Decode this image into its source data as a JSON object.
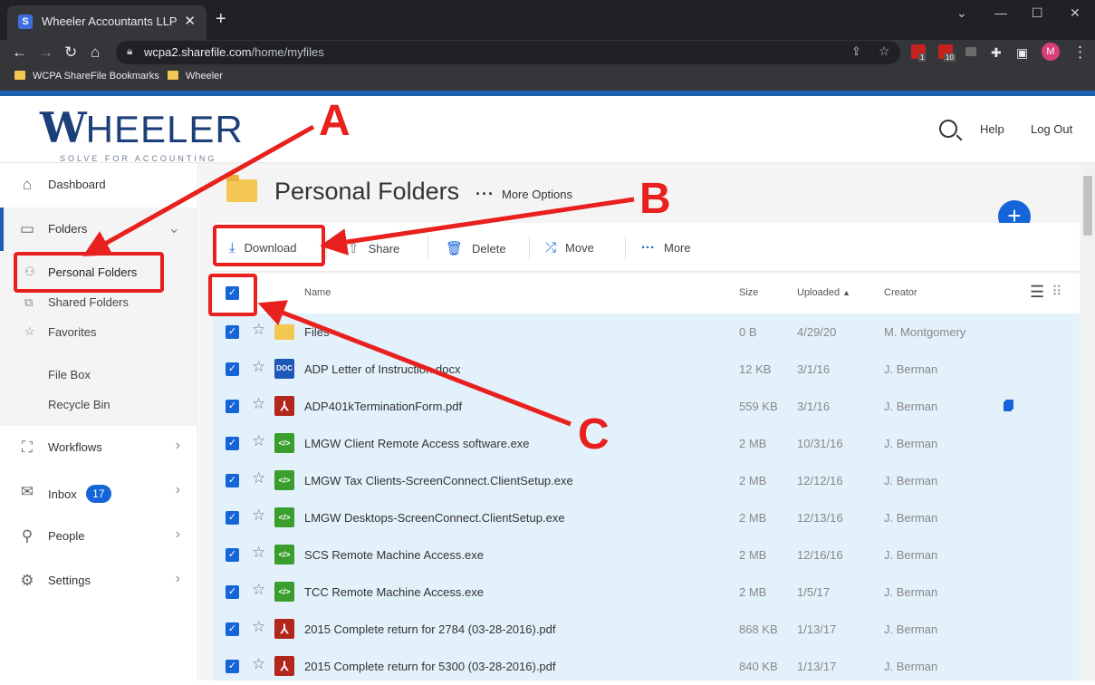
{
  "browser": {
    "tab_title": "Wheeler Accountants LLP",
    "favicon_letter": "S",
    "new_tab": "+",
    "url_host": "wcpa2.sharefile.com",
    "url_path": "/home/myfiles",
    "avatar_letter": "M",
    "bookmarks": [
      "WCPA ShareFile Bookmarks",
      "Wheeler"
    ],
    "ext_badges": [
      "1",
      "10"
    ]
  },
  "header": {
    "logo_letter": "W",
    "logo_rest": "HEELER",
    "logo_tagline": "SOLVE FOR ACCOUNTING",
    "help": "Help",
    "logout": "Log Out"
  },
  "sidebar": {
    "dashboard": "Dashboard",
    "folders": "Folders",
    "personal_folders": "Personal Folders",
    "shared_folders": "Shared Folders",
    "favorites": "Favorites",
    "file_box": "File Box",
    "recycle_bin": "Recycle Bin",
    "workflows": "Workflows",
    "inbox": "Inbox",
    "inbox_count": "17",
    "people": "People",
    "settings": "Settings"
  },
  "main": {
    "title": "Personal Folders",
    "more_options": "More Options",
    "add": "+",
    "toolbar": {
      "download": "Download",
      "share": "Share",
      "delete": "Delete",
      "move": "Move",
      "more": "More"
    },
    "columns": {
      "name": "Name",
      "size": "Size",
      "uploaded": "Uploaded",
      "creator": "Creator"
    },
    "rows": [
      {
        "name": "Files",
        "size": "0 B",
        "uploaded": "4/29/20",
        "creator": "M. Montgomery",
        "type": "folder"
      },
      {
        "name": "ADP Letter of Instruction.docx",
        "size": "12 KB",
        "uploaded": "3/1/16",
        "creator": "J. Berman",
        "type": "DOC"
      },
      {
        "name": "ADP401kTerminationForm.pdf",
        "size": "559 KB",
        "uploaded": "3/1/16",
        "creator": "J. Berman",
        "type": "pdf"
      },
      {
        "name": "LMGW Client Remote Access software.exe",
        "size": "2 MB",
        "uploaded": "10/31/16",
        "creator": "J. Berman",
        "type": "exe"
      },
      {
        "name": "LMGW Tax Clients-ScreenConnect.ClientSetup.exe",
        "size": "2 MB",
        "uploaded": "12/12/16",
        "creator": "J. Berman",
        "type": "exe"
      },
      {
        "name": "LMGW Desktops-ScreenConnect.ClientSetup.exe",
        "size": "2 MB",
        "uploaded": "12/13/16",
        "creator": "J. Berman",
        "type": "exe"
      },
      {
        "name": "SCS Remote Machine Access.exe",
        "size": "2 MB",
        "uploaded": "12/16/16",
        "creator": "J. Berman",
        "type": "exe"
      },
      {
        "name": "TCC Remote Machine Access.exe",
        "size": "2 MB",
        "uploaded": "1/5/17",
        "creator": "J. Berman",
        "type": "exe"
      },
      {
        "name": "2015 Complete return for 2784 (03-28-2016).pdf",
        "size": "868 KB",
        "uploaded": "1/13/17",
        "creator": "J. Berman",
        "type": "pdf"
      },
      {
        "name": "2015 Complete return for 5300 (03-28-2016).pdf",
        "size": "840 KB",
        "uploaded": "1/13/17",
        "creator": "J. Berman",
        "type": "pdf"
      }
    ]
  },
  "annotations": {
    "a": "A",
    "b": "B",
    "c": "C",
    "color": "#e8211f"
  },
  "colors": {
    "brand": "#1c3f7a",
    "accent": "#1565d8",
    "selected_row": "#e3f1fb"
  }
}
